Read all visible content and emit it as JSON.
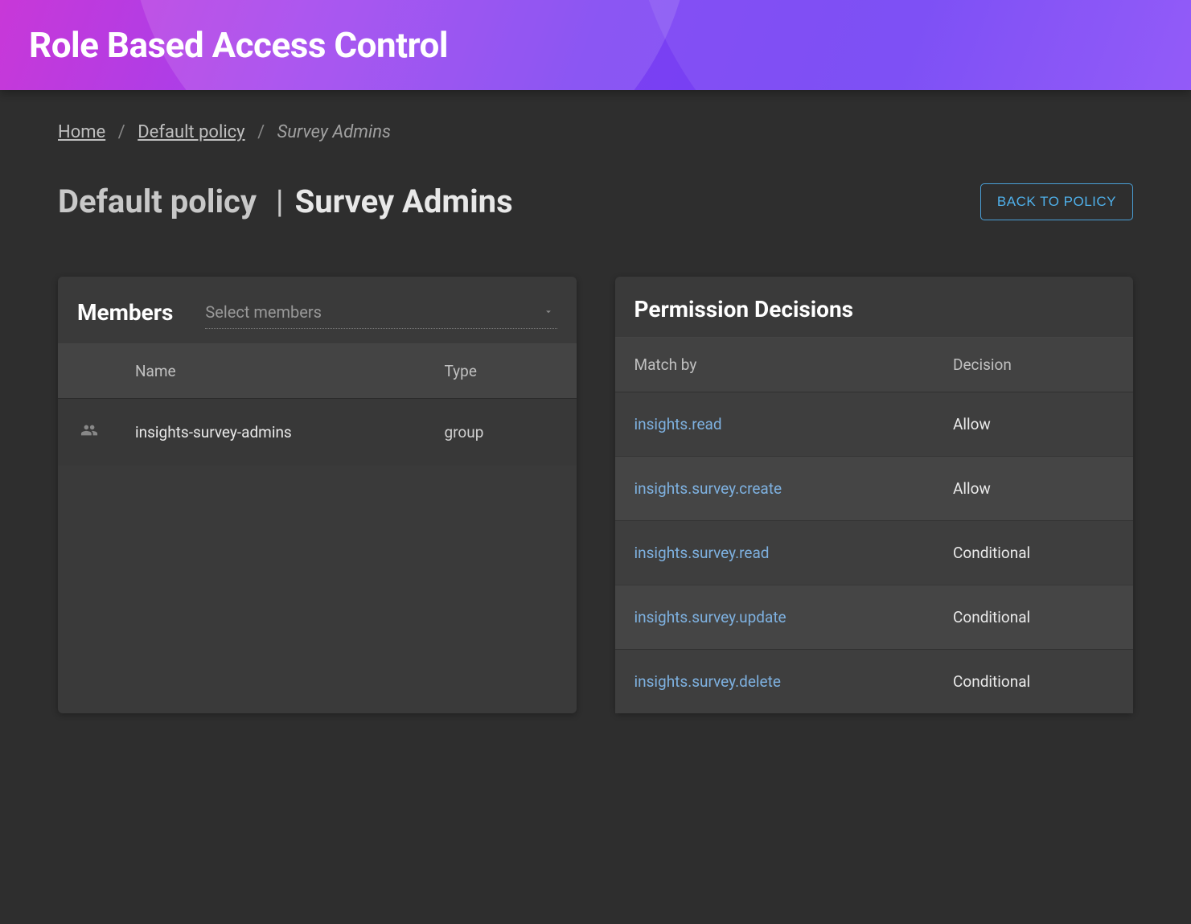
{
  "header": {
    "title": "Role Based Access Control"
  },
  "breadcrumb": {
    "home": "Home",
    "policy": "Default policy",
    "role": "Survey Admins"
  },
  "page": {
    "policy_label": "Default policy",
    "role_label": "Survey Admins",
    "back_button": "BACK TO POLICY"
  },
  "members_panel": {
    "title": "Members",
    "select_placeholder": "Select members",
    "columns": {
      "name": "Name",
      "type": "Type"
    },
    "rows": [
      {
        "name": "insights-survey-admins",
        "type": "group",
        "icon": "group-icon"
      }
    ]
  },
  "permissions_panel": {
    "title": "Permission Decisions",
    "columns": {
      "match": "Match by",
      "decision": "Decision"
    },
    "rows": [
      {
        "match": "insights.read",
        "decision": "Allow"
      },
      {
        "match": "insights.survey.create",
        "decision": "Allow"
      },
      {
        "match": "insights.survey.read",
        "decision": "Conditional"
      },
      {
        "match": "insights.survey.update",
        "decision": "Conditional"
      },
      {
        "match": "insights.survey.delete",
        "decision": "Conditional"
      }
    ]
  }
}
